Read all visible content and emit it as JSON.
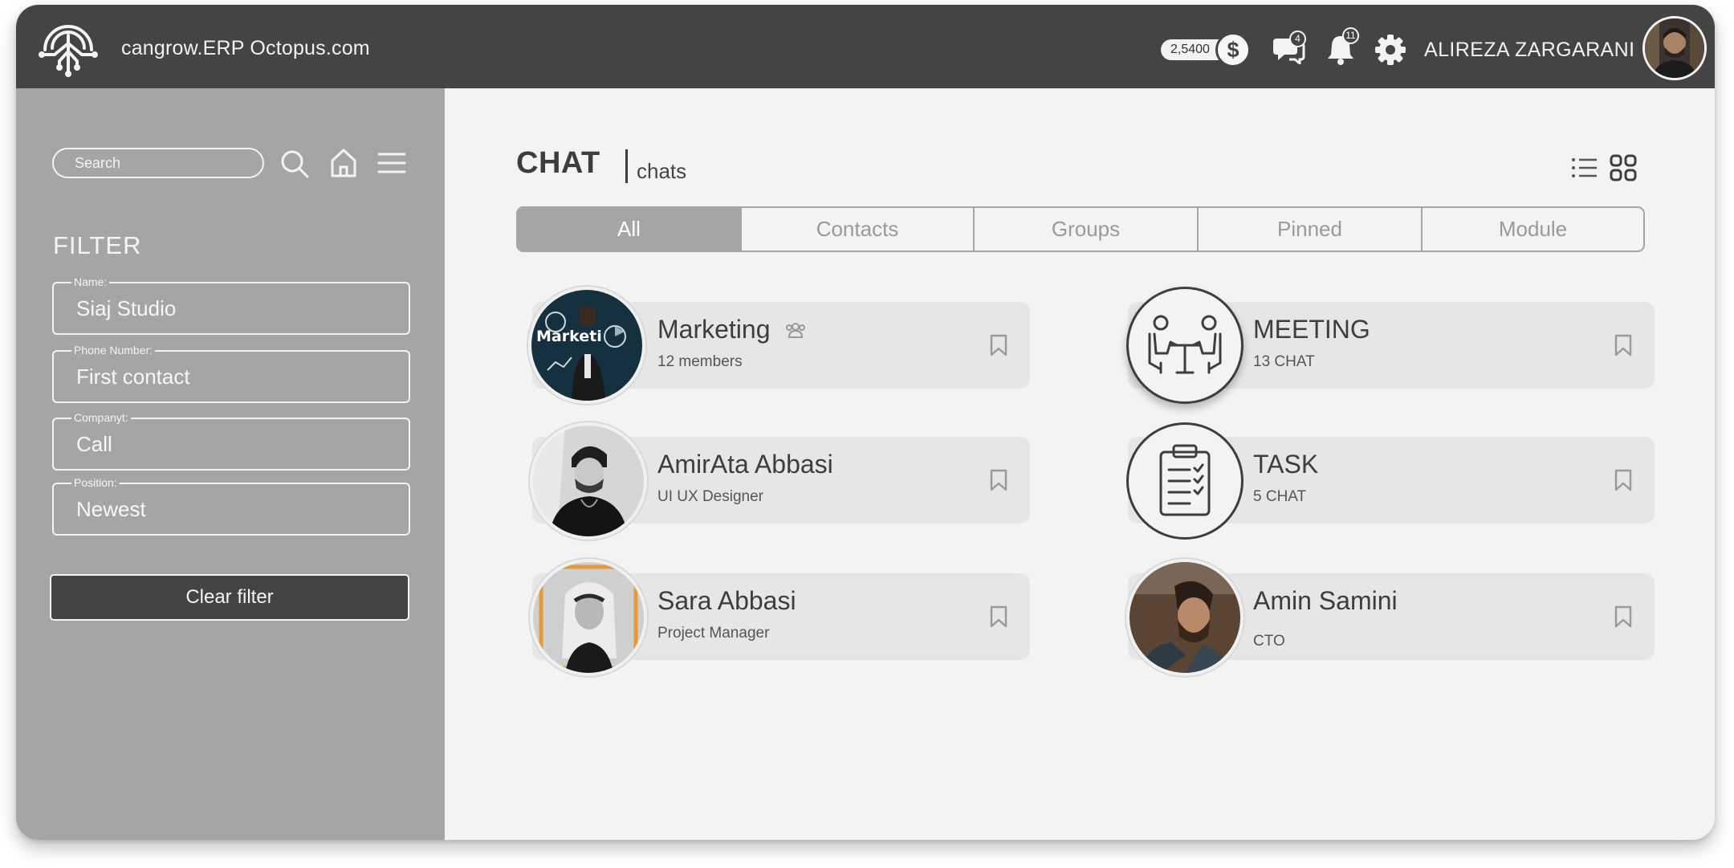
{
  "header": {
    "brand": "cangrow.ERP Octopus.com",
    "balance": "2,5400",
    "currency_symbol": "$",
    "messages_badge": "4",
    "notifications_badge": "11",
    "user_name": "ALIREZA ZARGARANI",
    "icons": [
      "octopus-logo-icon",
      "dollar-icon",
      "chat-bubbles-icon",
      "bell-icon",
      "gear-icon"
    ]
  },
  "sidebar": {
    "search_placeholder": "Search",
    "icons": [
      "search-icon",
      "home-icon",
      "menu-icon"
    ],
    "filter_title": "FILTER",
    "fields": [
      {
        "label": "Name:",
        "value": "Siaj Studio"
      },
      {
        "label": "Phone Number:",
        "value": "First contact"
      },
      {
        "label": "Companyt:",
        "value": "Call"
      },
      {
        "label": "Position:",
        "value": "Newest"
      }
    ],
    "clear_label": "Clear filter"
  },
  "main": {
    "title": "CHAT",
    "subtitle": "chats",
    "view_icons": [
      "list-view-icon",
      "grid-view-icon"
    ],
    "tabs": [
      {
        "label": "All",
        "active": true
      },
      {
        "label": "Contacts",
        "active": false
      },
      {
        "label": "Groups",
        "active": false
      },
      {
        "label": "Pinned",
        "active": false
      },
      {
        "label": "Module",
        "active": false
      }
    ],
    "chats": [
      {
        "title": "Marketing",
        "subtitle": "12 members",
        "avatar": "marketing-photo",
        "group": true
      },
      {
        "title": "MEETING",
        "subtitle": "13 CHAT",
        "avatar": "meeting-icon"
      },
      {
        "title": "AmirAta Abbasi",
        "subtitle": "UI UX Designer",
        "avatar": "amirata-photo"
      },
      {
        "title": "TASK",
        "subtitle": "5 CHAT",
        "avatar": "clipboard-icon"
      },
      {
        "title": "Sara Abbasi",
        "subtitle": "Project Manager",
        "avatar": "sara-photo"
      },
      {
        "title": "Amin Samini",
        "subtitle": "CTO",
        "avatar": "amin-photo"
      }
    ]
  },
  "colors": {
    "header_bg": "#444444",
    "sidebar_bg": "#a5a5a5",
    "main_bg": "#f3f3f3",
    "card_bg": "#e6e6e6",
    "button_bg": "#444444"
  }
}
